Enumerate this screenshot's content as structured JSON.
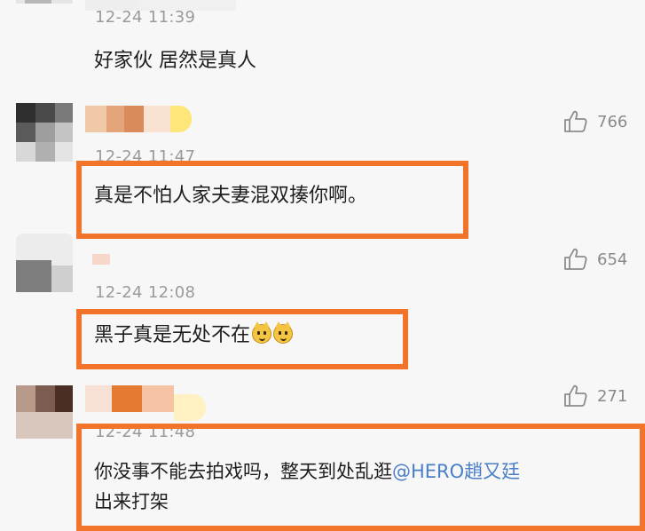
{
  "comments": [
    {
      "time": "12-24 11:39",
      "text": "好家伙 居然是真人"
    },
    {
      "time": "12-24 11:47",
      "text": "真是不怕人家夫妻混双揍你啊。",
      "likes": "766",
      "like_icon": "thumb-up-icon"
    },
    {
      "time": "12-24 12:08",
      "text": "黑子真是无处不在",
      "emoji": "smiling-cat-emoji",
      "likes": "654",
      "like_icon": "thumb-up-icon"
    },
    {
      "time": "12-24 11:48",
      "text_line1": "你没事不能去拍戏吗，整天到处乱逛",
      "mention": "@HERO趙又廷",
      "text_line2": "出来打架",
      "likes": "271",
      "like_icon": "thumb-up-icon"
    }
  ],
  "colors": {
    "highlight_border": "#f2742b",
    "mention": "#4a7fc8",
    "timestamp": "#9a9a9a",
    "background": "#f7f7f7"
  }
}
